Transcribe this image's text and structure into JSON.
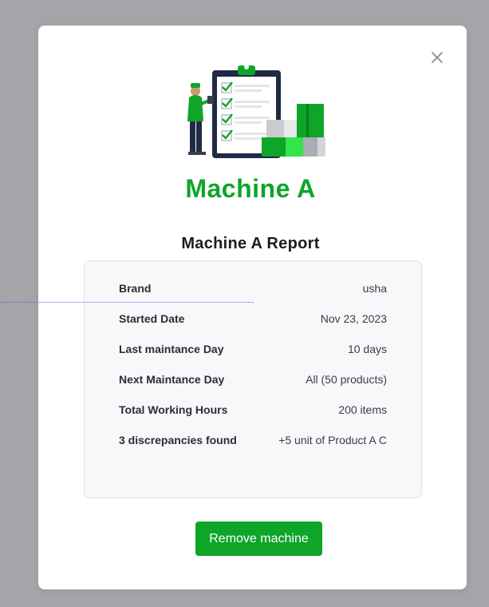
{
  "modal": {
    "title": "Machine A",
    "subtitle": "Machine A Report",
    "close_icon": "close-icon",
    "illustration": "checklist-worker-boxes-illustration",
    "details": [
      {
        "label": "Brand",
        "value": "usha"
      },
      {
        "label": "Started Date",
        "value": "Nov 23, 2023"
      },
      {
        "label": "Last maintance Day",
        "value": "10 days"
      },
      {
        "label": "Next Maintance Day",
        "value": "All (50 products)"
      },
      {
        "label": "Total Working Hours",
        "value": "200 items"
      },
      {
        "label": "3 discrepancies found",
        "value": "+5 unit of Product A C"
      }
    ],
    "remove_label": "Remove machine"
  },
  "colors": {
    "accent": "#0ea529",
    "overlay": "#a4a5a8",
    "card_bg": "#f7f8fa"
  }
}
